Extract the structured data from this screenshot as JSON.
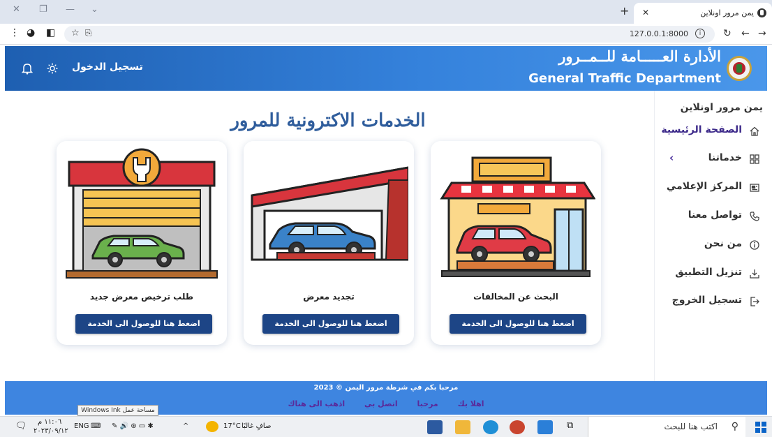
{
  "browser": {
    "tab_title": "يمن مرور اونلاين",
    "url": "127.0.0.1:8000"
  },
  "header": {
    "title_ar": "الأدارة العـــــامة للــمــرور",
    "title_en": "General Traffic Department",
    "login_label": "تسجيل الدخول"
  },
  "sidebar": {
    "title": "يمن مرور اونلاين",
    "items": [
      {
        "label": "الصفحة الرئيسية",
        "icon": "home-icon"
      },
      {
        "label": "خدماتنا",
        "icon": "grid-icon"
      },
      {
        "label": "المركز الإعلامي",
        "icon": "newspaper-icon"
      },
      {
        "label": "تواصل معنا",
        "icon": "phone-icon"
      },
      {
        "label": "من نحن",
        "icon": "info-icon"
      },
      {
        "label": "تنزيل التطبيق",
        "icon": "download-icon"
      },
      {
        "label": "تسجيل الخروج",
        "icon": "logout-icon"
      }
    ]
  },
  "main": {
    "title": "الخدمات الاكترونية للمرور",
    "cards": [
      {
        "title": "البحث عن المخالفات",
        "button": "اضغط هنا للوصول الى الخدمة"
      },
      {
        "title": "تجديد معرض",
        "button": "اضغط هنا للوصول الى الخدمة"
      },
      {
        "title": "طلب ترخيص معرض جديد",
        "button": "اضغط هنا للوصول الى الخدمة"
      }
    ]
  },
  "footer": {
    "message": "مرحبا بكم في شرطة مرور اليمن © 2023",
    "links": [
      "اهلا بك",
      "مرحبا",
      "اتصل بي",
      "اذهب الى هناك"
    ]
  },
  "taskbar": {
    "search_placeholder": "اكتب هنا للبحث",
    "weather": "صافٍ غالبًا",
    "temperature": "17°C",
    "language": "ENG",
    "time": "١١:٠٦ م",
    "date": "٢٠٢٣/٠٩/١٢",
    "tooltip": "مساحة عمل Windows Ink"
  },
  "colors": {
    "header_start": "#1e5fb1",
    "header_end": "#4a97ea",
    "button": "#1d4586",
    "title": "#2f5d9c",
    "footer": "#3e85e0"
  }
}
